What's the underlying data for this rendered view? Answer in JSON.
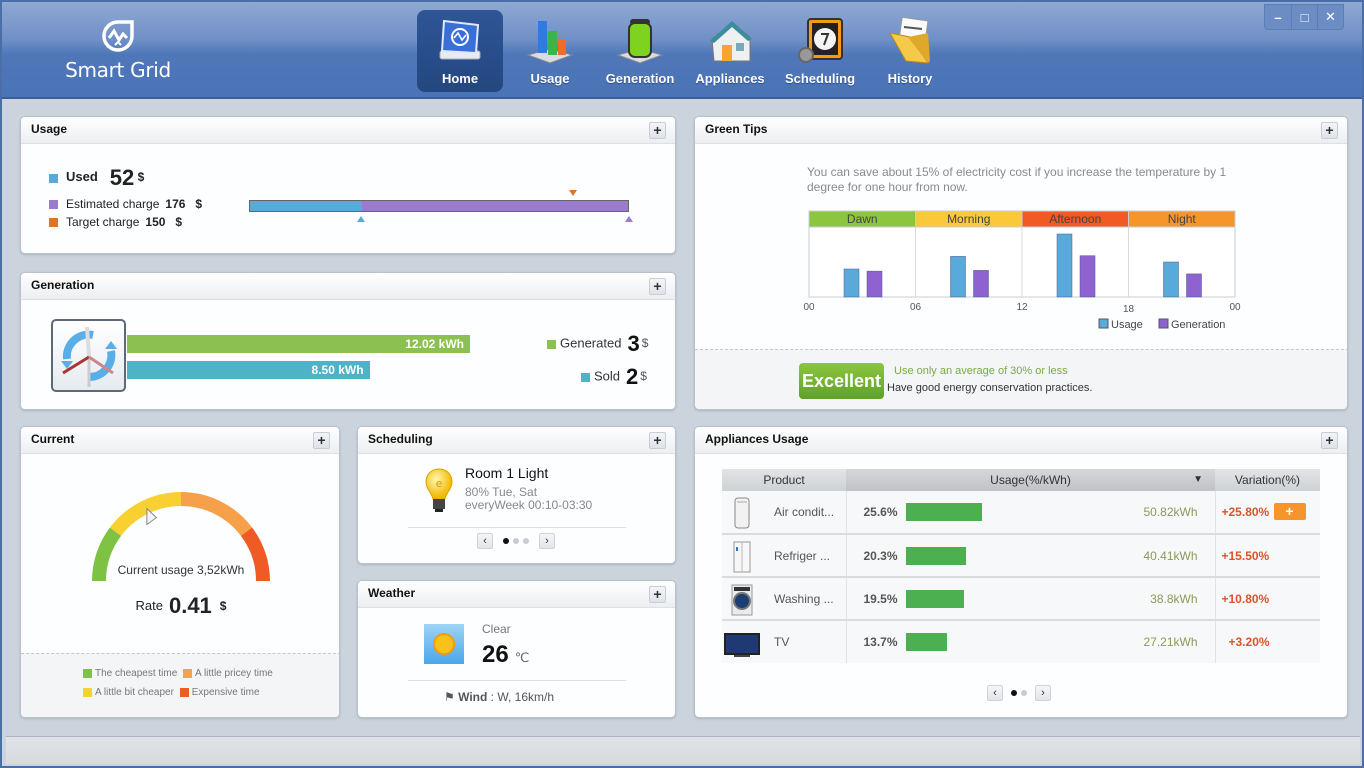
{
  "app": {
    "name": "Smart Grid",
    "window_controls": [
      "minimize",
      "maximize",
      "close"
    ]
  },
  "nav": {
    "items": [
      {
        "label": "Home",
        "icon": "home-monitor-icon",
        "active": true
      },
      {
        "label": "Usage",
        "icon": "bar-chart-icon",
        "active": false
      },
      {
        "label": "Generation",
        "icon": "battery-icon",
        "active": false
      },
      {
        "label": "Appliances",
        "icon": "house-icon",
        "active": false
      },
      {
        "label": "Scheduling",
        "icon": "clock-icon",
        "active": false
      },
      {
        "label": "History",
        "icon": "folder-icon",
        "active": false
      }
    ]
  },
  "usage": {
    "title": "Usage",
    "used_label": "Used",
    "used_value": "52",
    "currency": "$",
    "estimated_label": "Estimated charge",
    "estimated_value": "176",
    "target_label": "Target charge",
    "target_value": "150",
    "used_fraction_of_estimated": 0.295,
    "target_fraction_of_estimated": 0.852,
    "colors": {
      "used": "#5aa9db",
      "estimated": "#9b7bd0",
      "target": "#d9762b"
    }
  },
  "generation": {
    "title": "Generation",
    "generated_kwh": "12.02 kWh",
    "sold_kwh": "8.50 kWh",
    "generated_kwh_value": 12.02,
    "sold_kwh_value": 8.5,
    "generated_label": "Generated",
    "generated_value": "3",
    "sold_label": "Sold",
    "sold_value": "2",
    "currency": "$",
    "colors": {
      "generated": "#8cc152",
      "sold": "#4fb3c8"
    }
  },
  "green_tips": {
    "title": "Green Tips",
    "tip_text": "You can save about 15% of electricity cost if you increase the temperature by 1 degree for one hour from now.",
    "badge": "Excellent",
    "badge_line1": "Use only an average of 30% or less",
    "badge_line2": "Have good energy conservation practices."
  },
  "chart_data": {
    "type": "bar",
    "title": "",
    "periods": [
      {
        "name": "Dawn",
        "color": "#8cc63f"
      },
      {
        "name": "Morning",
        "color": "#f9c93a"
      },
      {
        "name": "Afternoon",
        "color": "#f15a22"
      },
      {
        "name": "Night",
        "color": "#f7952d"
      }
    ],
    "categories": [
      "Dawn",
      "Morning",
      "Afternoon",
      "Night"
    ],
    "x_ticks": [
      "00",
      "06",
      "12",
      "18",
      "00"
    ],
    "series": [
      {
        "name": "Usage",
        "color": "#5aa9db",
        "values": [
          40,
          58,
          90,
          50
        ]
      },
      {
        "name": "Generation",
        "color": "#8e63cf",
        "values": [
          37,
          38,
          59,
          33
        ]
      }
    ],
    "ylim": [
      0,
      100
    ],
    "legend": "bottom-right",
    "grid": true
  },
  "current": {
    "title": "Current",
    "usage_label": "Current usage 3,52kWh",
    "rate_label": "Rate",
    "rate_value": "0.41",
    "rate_unit": "$",
    "gauge_fraction": 0.36,
    "legend": [
      {
        "label": "The cheapest time",
        "color": "#7dc242"
      },
      {
        "label": "A little pricey time",
        "color": "#f7a04a"
      },
      {
        "label": "A little bit cheaper",
        "color": "#f9d031"
      },
      {
        "label": "Expensive time",
        "color": "#f05a24"
      }
    ]
  },
  "scheduling": {
    "title": "Scheduling",
    "item_title": "Room 1 Light",
    "item_line1": "80% Tue, Sat",
    "item_line2": "everyWeek 00:10-03:30",
    "page": 1,
    "pages": 3
  },
  "weather": {
    "title": "Weather",
    "condition": "Clear",
    "temperature": "26",
    "unit": "℃",
    "wind_label": "Wind",
    "wind_value": ": W, 16km/h"
  },
  "appliances": {
    "title": "Appliances Usage",
    "columns": [
      "Product",
      "Usage(%/kWh)",
      "Variation(%)"
    ],
    "rows": [
      {
        "name": "Air condit...",
        "icon": "air-conditioner-icon",
        "pct": "25.6%",
        "pct_value": 25.6,
        "kwh": "50.82kWh",
        "variation": "+25.80%",
        "has_add": true
      },
      {
        "name": "Refriger ...",
        "icon": "refrigerator-icon",
        "pct": "20.3%",
        "pct_value": 20.3,
        "kwh": "40.41kWh",
        "variation": "+15.50%",
        "has_add": false
      },
      {
        "name": "Washing ...",
        "icon": "washing-machine-icon",
        "pct": "19.5%",
        "pct_value": 19.5,
        "kwh": "38.8kWh",
        "variation": "+10.80%",
        "has_add": false
      },
      {
        "name": "TV",
        "icon": "tv-icon",
        "pct": "13.7%",
        "pct_value": 13.7,
        "kwh": "27.21kWh",
        "variation": "+3.20%",
        "has_add": false
      }
    ],
    "add_label": "+",
    "page": 1,
    "pages": 2
  }
}
